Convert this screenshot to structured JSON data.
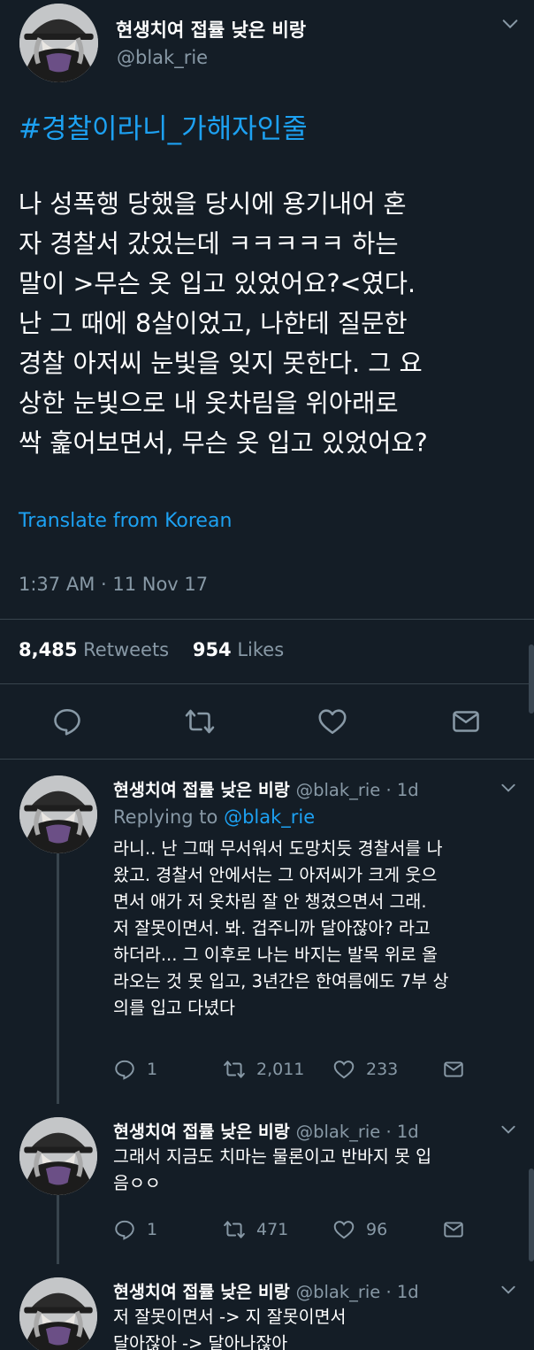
{
  "colors": {
    "background": "#141d26",
    "accent": "#1da1f2",
    "muted": "#8899a6",
    "divider": "#38444d"
  },
  "main_tweet": {
    "author_name": "현생치여 접률 낮은 비랑",
    "handle": "@blak_rie",
    "hashtag": "#경찰이라니_가해자인줄",
    "body_lines": [
      "나 성폭행 당했을 당시에 용기내어 혼",
      "자 경찰서 갔었는데 ㅋㅋㅋㅋㅋ 하는",
      "말이 >무슨 옷 입고 있었어요?<였다.",
      "난 그 때에 8살이었고, 나한테 질문한",
      "경찰 아저씨 눈빛을 잊지 못한다. 그 요",
      "상한 눈빛으로 내 옷차림을 위아래로",
      "싹 훑어보면서, 무슨 옷 입고 있었어요?"
    ],
    "translate_label": "Translate from Korean",
    "timestamp": "1:37 AM · 11 Nov 17",
    "retweets_count": "8,485",
    "retweets_label": "Retweets",
    "likes_count": "954",
    "likes_label": "Likes",
    "actions": [
      "reply-icon",
      "retweet-icon",
      "like-icon",
      "message-icon"
    ]
  },
  "replies": [
    {
      "author_name": "현생치여 접률 낮은 비랑",
      "handle_time": "@blak_rie · 1d",
      "replying_prefix": "Replying to",
      "replying_handle": "@blak_rie",
      "lines": [
        "라니.. 난 그때 무서워서 도망치듯 경찰서를 나",
        "왔고. 경찰서 안에서는 그 아저씨가 크게 웃으",
        "면서 애가 저 옷차림 잘 안 챙겼으면서 그래.",
        "저 잘못이면서. 봐. 겁주니까 달아잖아? 라고",
        "하더라... 그 이후로 나는 바지는 발목 위로 올",
        "라오는 것 못 입고, 3년간은 한여름에도 7부 상",
        "의를 입고 다녔다"
      ],
      "reply_count": "1",
      "retweet_count": "2,011",
      "like_count": "233"
    },
    {
      "author_name": "현생치여 접률 낮은 비랑",
      "handle_time": "@blak_rie · 1d",
      "lines": [
        "그래서 지금도 치마는 물론이고 반바지 못 입",
        "음ㅇㅇ"
      ],
      "reply_count": "1",
      "retweet_count": "471",
      "like_count": "96"
    },
    {
      "author_name": "현생치여 접률 낮은 비랑",
      "handle_time": "@blak_rie · 1d",
      "lines": [
        "저 잘못이면서 -> 지 잘못이면서",
        "달아잖아 -> 달아나잖아"
      ]
    }
  ]
}
